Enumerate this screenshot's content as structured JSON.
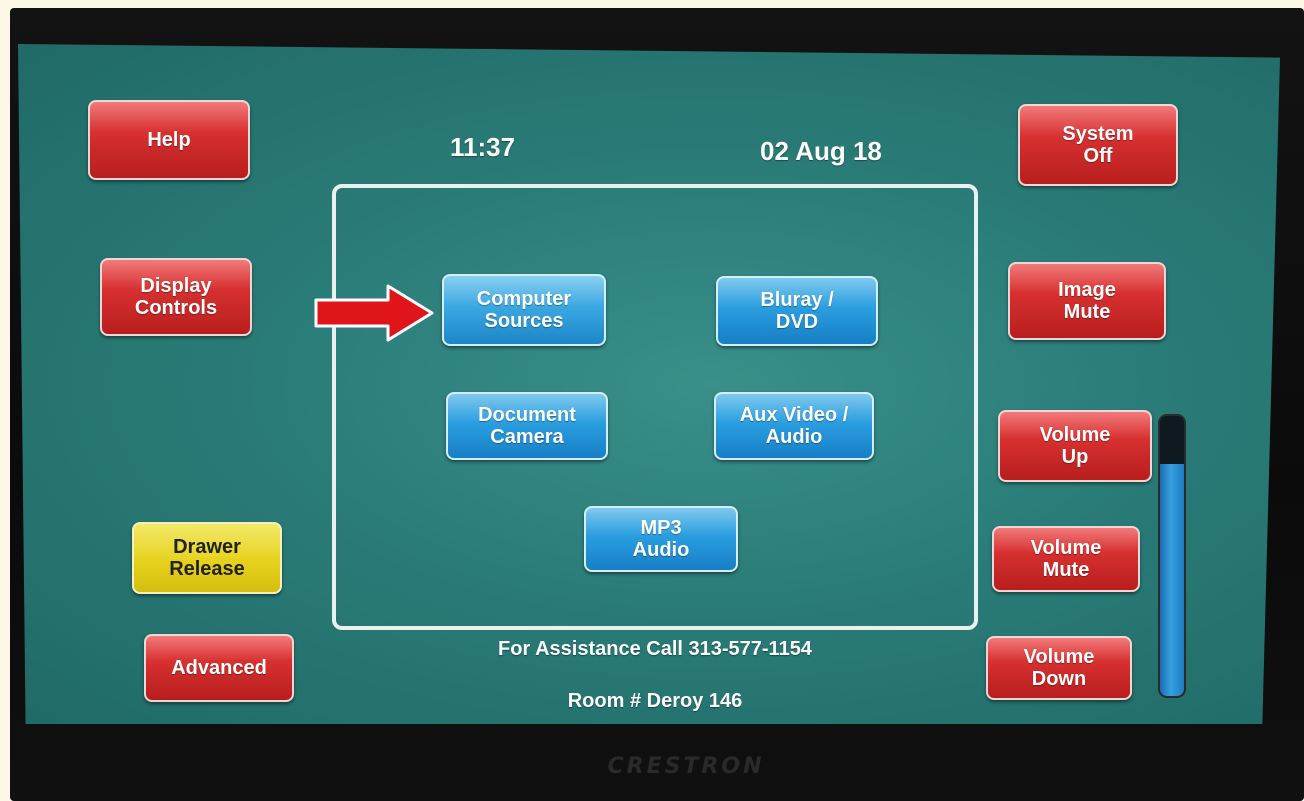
{
  "header": {
    "time": "11:37",
    "date": "02 Aug 18"
  },
  "left_buttons": {
    "help": "Help",
    "display_controls": "Display\nControls",
    "drawer_release": "Drawer\nRelease",
    "advanced": "Advanced"
  },
  "right_buttons": {
    "system_off": "System\nOff",
    "image_mute": "Image\nMute",
    "volume_up": "Volume\nUp",
    "volume_mute": "Volume\nMute",
    "volume_down": "Volume\nDown"
  },
  "sources": {
    "computer": "Computer\nSources",
    "bluray": "Bluray /\nDVD",
    "document_camera": "Document\nCamera",
    "aux_video": "Aux Video /\nAudio",
    "mp3": "MP3\nAudio"
  },
  "footer": {
    "assistance": "For Assistance Call 313-577-1154",
    "room": "Room # Deroy 146"
  },
  "volume": {
    "level": 0.83
  },
  "brand": "CRESTRON",
  "colors": {
    "screen_bg": "#2a7c78",
    "red_button": "#d73030",
    "blue_button": "#2a9ee0",
    "yellow_button": "#e6d21c",
    "arrow": "#e0151c"
  }
}
